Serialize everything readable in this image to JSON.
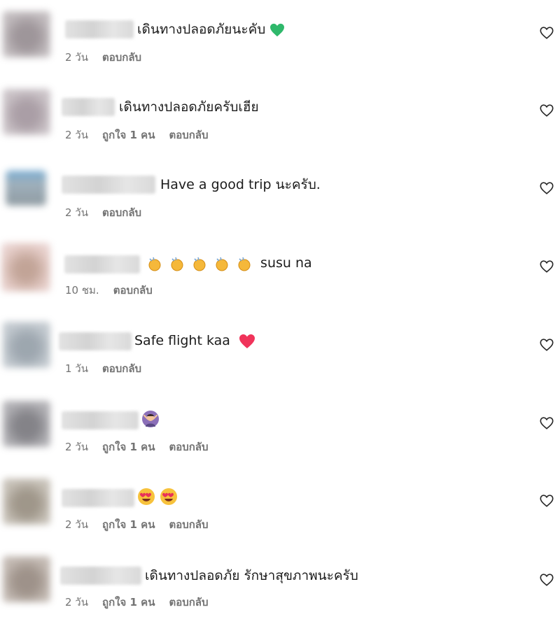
{
  "comments": [
    {
      "text": "เดินทางปลอดภัยนะคับ",
      "emoji": "green-heart",
      "time": "2 วัน",
      "likes": "",
      "reply": "ตอบกลับ",
      "avatar_color": "#9a8f93"
    },
    {
      "text": "เดินทางปลอดภัยครับเฮีย",
      "emoji": "",
      "time": "2 วัน",
      "likes": "ถูกใจ 1 คน",
      "reply": "ตอบกลับ",
      "avatar_color": "#a79aa3"
    },
    {
      "text": "Have a good trip นะครับ.",
      "emoji": "",
      "time": "2 วัน",
      "likes": "",
      "reply": "ตอบกลับ",
      "avatar_color": "#8a9aa4"
    },
    {
      "text": "susu na",
      "emoji": "clap-x5",
      "time": "10 ชม.",
      "likes": "",
      "reply": "ตอบกลับ",
      "avatar_color": "#c7a99b"
    },
    {
      "text": "Safe flight kaa",
      "emoji": "red-heart",
      "time": "1 วัน",
      "likes": "",
      "reply": "ตอบกลับ",
      "avatar_color": "#98a3ad"
    },
    {
      "text": "",
      "emoji": "person-gesture",
      "time": "2 วัน",
      "likes": "ถูกใจ 1 คน",
      "reply": "ตอบกลับ",
      "avatar_color": "#7f7e84"
    },
    {
      "text": "",
      "emoji": "heart-eyes-x2",
      "time": "2 วัน",
      "likes": "ถูกใจ 1 คน",
      "reply": "ตอบกลับ",
      "avatar_color": "#a0978c"
    },
    {
      "text": "เดินทางปลอดภัย รักษาสุขภาพนะครับ",
      "emoji": "",
      "time": "2 วัน",
      "likes": "ถูกใจ 1 คน",
      "reply": "ตอบกลับ",
      "avatar_color": "#9a8e87"
    }
  ],
  "icons": {
    "like": "heart-outline-icon"
  }
}
